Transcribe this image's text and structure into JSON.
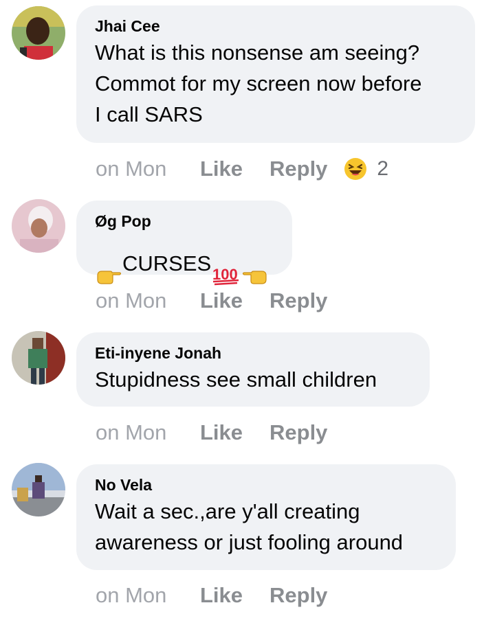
{
  "comments": [
    {
      "author": "Jhai Cee",
      "text": "What is this nonsense am seeing?\nCommot for my screen now before\nI call SARS",
      "time": "on Mon",
      "like": "Like",
      "reply": "Reply",
      "reaction_icon": "laughing-squint-emoji",
      "reaction_count": "2"
    },
    {
      "author": "Øg Pop",
      "text_main": "CURSES",
      "time": "on Mon",
      "like": "Like",
      "reply": "Reply",
      "emojis": [
        "point-right-hand",
        "hundred-points",
        "point-left-hand"
      ]
    },
    {
      "author": "Eti-inyene Jonah",
      "text": "Stupidness see small children",
      "time": "on Mon",
      "like": "Like",
      "reply": "Reply"
    },
    {
      "author": "No Vela",
      "text": "Wait a sec.,are y'all creating\nawareness or just fooling around",
      "time": "on Mon",
      "like": "Like",
      "reply": "Reply"
    }
  ]
}
